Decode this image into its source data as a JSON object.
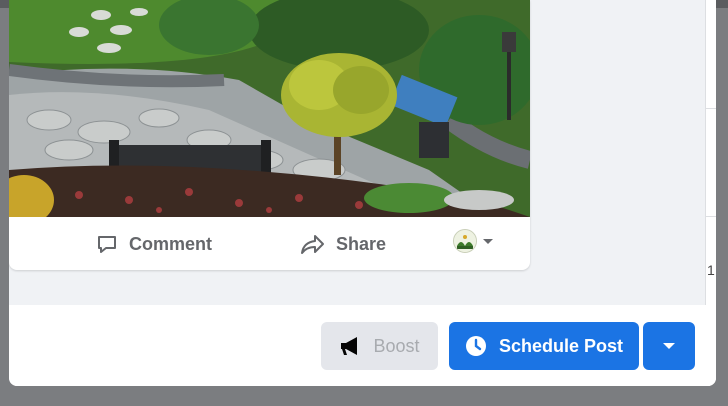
{
  "post": {
    "comment_label": "Comment",
    "share_label": "Share"
  },
  "footer": {
    "boost_label": "Boost",
    "schedule_label": "Schedule Post"
  },
  "colors": {
    "primary": "#1b74e4",
    "disabled_bg": "#e4e6eb",
    "disabled_text": "#a8abaf",
    "action_text": "#65676b"
  },
  "icons": {
    "comment": "comment-icon",
    "share": "share-icon",
    "audience": "audience-avatar",
    "boost": "megaphone-icon",
    "schedule": "clock-icon",
    "dropdown": "caret-down-icon"
  },
  "side": {
    "glyph": "1"
  }
}
